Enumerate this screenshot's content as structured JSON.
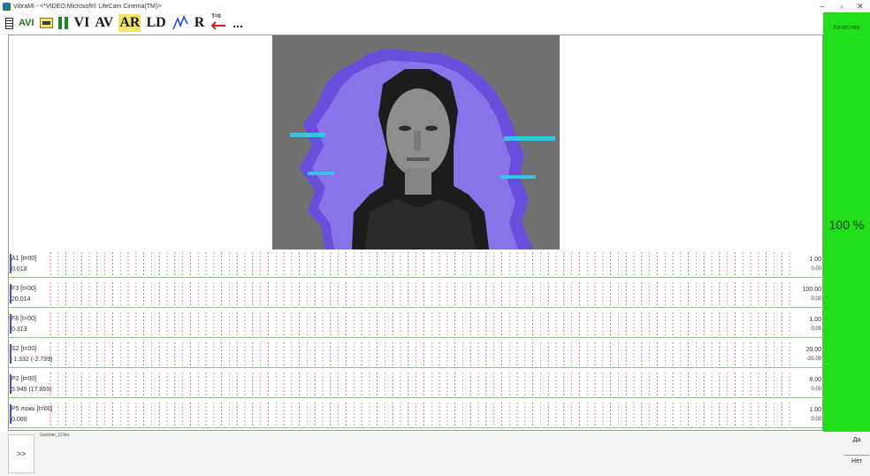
{
  "window": {
    "title": "VibraMI - <*VIDEO:Microsoft® LifeCam Cinema(TM)>",
    "minimize": "–",
    "maximize": "▫",
    "close": "✕"
  },
  "toolbar": {
    "avi": "AVI",
    "vi": "VI",
    "av": "AV",
    "ar": "AR",
    "ld": "LD",
    "r": "R",
    "t0": "T=0",
    "more": "..."
  },
  "sidebar": {
    "quality_label": "Качество",
    "quality_value": "100 %",
    "color": "#22dd1a"
  },
  "graphs": [
    {
      "name": "A1 [t=00]",
      "value": "0.018",
      "max": "1.00",
      "min": "0.00"
    },
    {
      "name": "F3 [t=00]",
      "value": "20.014",
      "max": "100.00",
      "min": "0.00"
    },
    {
      "name": "F8 [t=00]",
      "value": "0.313",
      "max": "1.00",
      "min": "0.00"
    },
    {
      "name": "S2 [t=00]",
      "value": "-1.332 (-2.739)",
      "max": "20.00",
      "min": "-20.00"
    },
    {
      "name": "P2 [t=00]",
      "value": "5.949 (17.869)",
      "max": "8.00",
      "min": "0.00"
    },
    {
      "name": "P5 ложь [t=00]",
      "value": "0.000",
      "max": "1.00",
      "min": "0.00"
    }
  ],
  "bottom": {
    "expand": ">>",
    "file": "Gentner_t2.bts",
    "yes": "Да",
    "no": "Нет"
  }
}
